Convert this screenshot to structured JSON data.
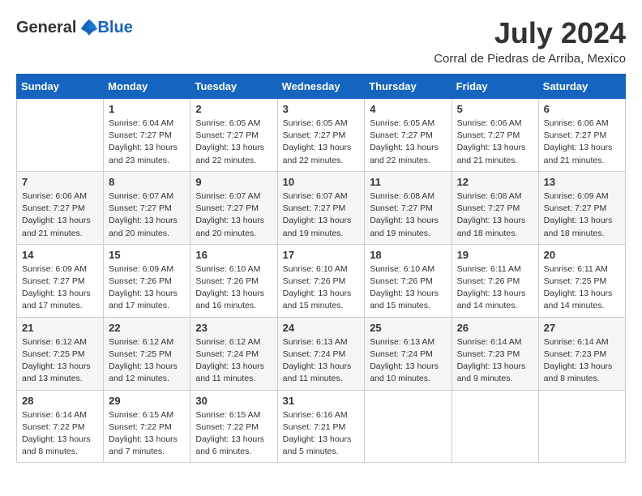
{
  "header": {
    "logo_general": "General",
    "logo_blue": "Blue",
    "month_title": "July 2024",
    "location": "Corral de Piedras de Arriba, Mexico"
  },
  "weekdays": [
    "Sunday",
    "Monday",
    "Tuesday",
    "Wednesday",
    "Thursday",
    "Friday",
    "Saturday"
  ],
  "weeks": [
    [
      {
        "day": "",
        "sunrise": "",
        "sunset": "",
        "daylight": ""
      },
      {
        "day": "1",
        "sunrise": "Sunrise: 6:04 AM",
        "sunset": "Sunset: 7:27 PM",
        "daylight": "Daylight: 13 hours and 23 minutes."
      },
      {
        "day": "2",
        "sunrise": "Sunrise: 6:05 AM",
        "sunset": "Sunset: 7:27 PM",
        "daylight": "Daylight: 13 hours and 22 minutes."
      },
      {
        "day": "3",
        "sunrise": "Sunrise: 6:05 AM",
        "sunset": "Sunset: 7:27 PM",
        "daylight": "Daylight: 13 hours and 22 minutes."
      },
      {
        "day": "4",
        "sunrise": "Sunrise: 6:05 AM",
        "sunset": "Sunset: 7:27 PM",
        "daylight": "Daylight: 13 hours and 22 minutes."
      },
      {
        "day": "5",
        "sunrise": "Sunrise: 6:06 AM",
        "sunset": "Sunset: 7:27 PM",
        "daylight": "Daylight: 13 hours and 21 minutes."
      },
      {
        "day": "6",
        "sunrise": "Sunrise: 6:06 AM",
        "sunset": "Sunset: 7:27 PM",
        "daylight": "Daylight: 13 hours and 21 minutes."
      }
    ],
    [
      {
        "day": "7",
        "sunrise": "Sunrise: 6:06 AM",
        "sunset": "Sunset: 7:27 PM",
        "daylight": "Daylight: 13 hours and 21 minutes."
      },
      {
        "day": "8",
        "sunrise": "Sunrise: 6:07 AM",
        "sunset": "Sunset: 7:27 PM",
        "daylight": "Daylight: 13 hours and 20 minutes."
      },
      {
        "day": "9",
        "sunrise": "Sunrise: 6:07 AM",
        "sunset": "Sunset: 7:27 PM",
        "daylight": "Daylight: 13 hours and 20 minutes."
      },
      {
        "day": "10",
        "sunrise": "Sunrise: 6:07 AM",
        "sunset": "Sunset: 7:27 PM",
        "daylight": "Daylight: 13 hours and 19 minutes."
      },
      {
        "day": "11",
        "sunrise": "Sunrise: 6:08 AM",
        "sunset": "Sunset: 7:27 PM",
        "daylight": "Daylight: 13 hours and 19 minutes."
      },
      {
        "day": "12",
        "sunrise": "Sunrise: 6:08 AM",
        "sunset": "Sunset: 7:27 PM",
        "daylight": "Daylight: 13 hours and 18 minutes."
      },
      {
        "day": "13",
        "sunrise": "Sunrise: 6:09 AM",
        "sunset": "Sunset: 7:27 PM",
        "daylight": "Daylight: 13 hours and 18 minutes."
      }
    ],
    [
      {
        "day": "14",
        "sunrise": "Sunrise: 6:09 AM",
        "sunset": "Sunset: 7:27 PM",
        "daylight": "Daylight: 13 hours and 17 minutes."
      },
      {
        "day": "15",
        "sunrise": "Sunrise: 6:09 AM",
        "sunset": "Sunset: 7:26 PM",
        "daylight": "Daylight: 13 hours and 17 minutes."
      },
      {
        "day": "16",
        "sunrise": "Sunrise: 6:10 AM",
        "sunset": "Sunset: 7:26 PM",
        "daylight": "Daylight: 13 hours and 16 minutes."
      },
      {
        "day": "17",
        "sunrise": "Sunrise: 6:10 AM",
        "sunset": "Sunset: 7:26 PM",
        "daylight": "Daylight: 13 hours and 15 minutes."
      },
      {
        "day": "18",
        "sunrise": "Sunrise: 6:10 AM",
        "sunset": "Sunset: 7:26 PM",
        "daylight": "Daylight: 13 hours and 15 minutes."
      },
      {
        "day": "19",
        "sunrise": "Sunrise: 6:11 AM",
        "sunset": "Sunset: 7:26 PM",
        "daylight": "Daylight: 13 hours and 14 minutes."
      },
      {
        "day": "20",
        "sunrise": "Sunrise: 6:11 AM",
        "sunset": "Sunset: 7:25 PM",
        "daylight": "Daylight: 13 hours and 14 minutes."
      }
    ],
    [
      {
        "day": "21",
        "sunrise": "Sunrise: 6:12 AM",
        "sunset": "Sunset: 7:25 PM",
        "daylight": "Daylight: 13 hours and 13 minutes."
      },
      {
        "day": "22",
        "sunrise": "Sunrise: 6:12 AM",
        "sunset": "Sunset: 7:25 PM",
        "daylight": "Daylight: 13 hours and 12 minutes."
      },
      {
        "day": "23",
        "sunrise": "Sunrise: 6:12 AM",
        "sunset": "Sunset: 7:24 PM",
        "daylight": "Daylight: 13 hours and 11 minutes."
      },
      {
        "day": "24",
        "sunrise": "Sunrise: 6:13 AM",
        "sunset": "Sunset: 7:24 PM",
        "daylight": "Daylight: 13 hours and 11 minutes."
      },
      {
        "day": "25",
        "sunrise": "Sunrise: 6:13 AM",
        "sunset": "Sunset: 7:24 PM",
        "daylight": "Daylight: 13 hours and 10 minutes."
      },
      {
        "day": "26",
        "sunrise": "Sunrise: 6:14 AM",
        "sunset": "Sunset: 7:23 PM",
        "daylight": "Daylight: 13 hours and 9 minutes."
      },
      {
        "day": "27",
        "sunrise": "Sunrise: 6:14 AM",
        "sunset": "Sunset: 7:23 PM",
        "daylight": "Daylight: 13 hours and 8 minutes."
      }
    ],
    [
      {
        "day": "28",
        "sunrise": "Sunrise: 6:14 AM",
        "sunset": "Sunset: 7:22 PM",
        "daylight": "Daylight: 13 hours and 8 minutes."
      },
      {
        "day": "29",
        "sunrise": "Sunrise: 6:15 AM",
        "sunset": "Sunset: 7:22 PM",
        "daylight": "Daylight: 13 hours and 7 minutes."
      },
      {
        "day": "30",
        "sunrise": "Sunrise: 6:15 AM",
        "sunset": "Sunset: 7:22 PM",
        "daylight": "Daylight: 13 hours and 6 minutes."
      },
      {
        "day": "31",
        "sunrise": "Sunrise: 6:16 AM",
        "sunset": "Sunset: 7:21 PM",
        "daylight": "Daylight: 13 hours and 5 minutes."
      },
      {
        "day": "",
        "sunrise": "",
        "sunset": "",
        "daylight": ""
      },
      {
        "day": "",
        "sunrise": "",
        "sunset": "",
        "daylight": ""
      },
      {
        "day": "",
        "sunrise": "",
        "sunset": "",
        "daylight": ""
      }
    ]
  ]
}
